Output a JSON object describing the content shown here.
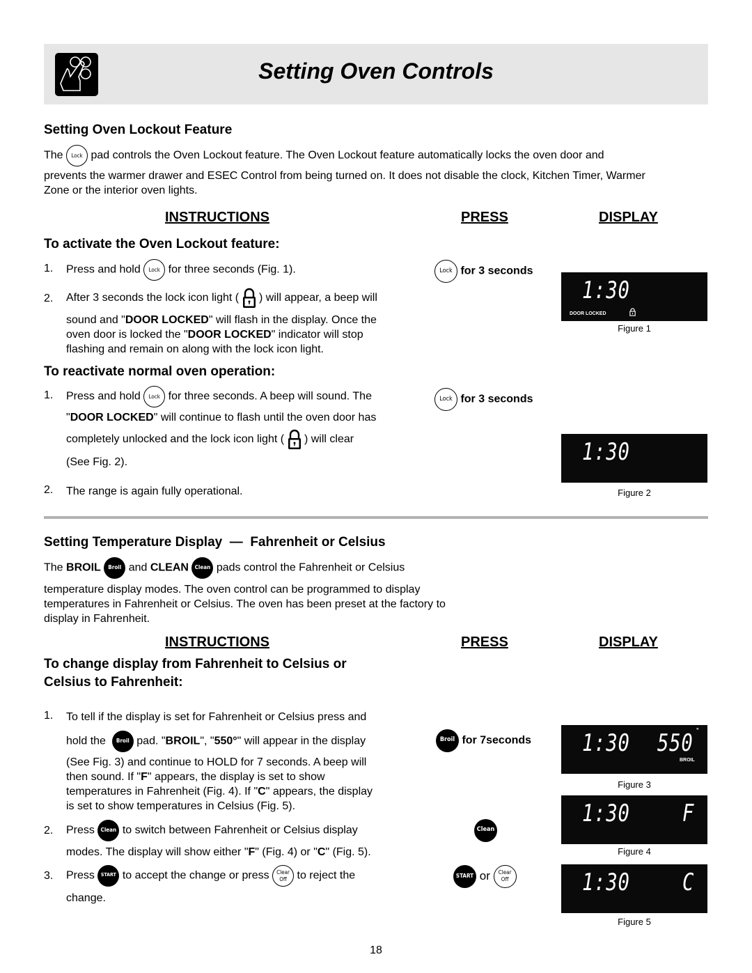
{
  "header": {
    "title": "Setting Oven Controls",
    "icon": "hand-pressing-buttons-icon"
  },
  "lockout": {
    "heading": "Setting Oven Lockout Feature",
    "intro_pre": "The",
    "intro_pad": "Lock",
    "intro_post": "pad controls the Oven Lockout feature. The Oven Lockout feature automatically locks the oven door and",
    "intro_line2": "prevents the warmer drawer and ESEC Control from being turned on.  It does not disable the clock, Kitchen Timer, Warmer",
    "intro_line3": "Zone or the interior oven lights.",
    "col_instructions": "INSTRUCTIONS",
    "col_press": "PRESS",
    "col_display": "DISPLAY",
    "activate": {
      "heading": "To activate the Oven Lockout feature:",
      "step1_num": "1.",
      "step1_pre": "Press and hold",
      "step1_pad": "Lock",
      "step1_post": "for three seconds (Fig. 1).",
      "step2_num": "2.",
      "step2_pre": "After 3 seconds the lock icon light (",
      "step2_post": ") will appear, a beep will",
      "step2_l2a": "sound and \"",
      "step2_l2b": "DOOR LOCKED",
      "step2_l2c": "\" will flash in the display. Once the",
      "step2_l3a": "oven door is locked the \"",
      "step2_l3b": "DOOR LOCKED",
      "step2_l3c": "\" indicator will stop",
      "step2_l4": "flashing and remain on along with the lock icon light.",
      "press_pad": "Lock",
      "press_label": "for 3 seconds",
      "display_time": "1:30",
      "display_indicator": "DOOR LOCKED",
      "figure": "Figure 1"
    },
    "reactivate": {
      "heading": "To reactivate normal oven operation:",
      "step1_num": "1.",
      "step1_pre": "Press and hold",
      "step1_pad": "Lock",
      "step1_post": "for three seconds. A beep will sound. The",
      "step1_l2a": "\"",
      "step1_l2b": "DOOR LOCKED",
      "step1_l2c": "\" will continue to flash until the oven door has",
      "step1_l3a": "completely unlocked and the lock icon light (",
      "step1_l3b": ") will clear",
      "step1_l4": "(See Fig. 2).",
      "step2_num": "2.",
      "step2": "The range is again fully operational.",
      "press_pad": "Lock",
      "press_label": "for 3 seconds",
      "display_time": "1:30",
      "figure": "Figure 2"
    }
  },
  "temperature": {
    "heading": "Setting Temperature Display  —  Fahrenheit or Celsius",
    "intro_a": "The ",
    "intro_broil": "BROIL",
    "intro_pad_broil": "Broil",
    "intro_and": "and ",
    "intro_clean": "CLEAN",
    "intro_pad_clean": "Clean",
    "intro_post": "pads control the Fahrenheit or Celsius",
    "intro_l2": "temperature display modes. The oven control can be programmed to display",
    "intro_l3": "temperatures in Fahrenheit or Celsius.  The oven has been preset at the factory to",
    "intro_l4": "display in Fahrenheit.",
    "col_instructions": "INSTRUCTIONS",
    "col_press": "PRESS",
    "col_display": "DISPLAY",
    "change_heading_l1": "To change display from Fahrenheit to Celsius or",
    "change_heading_l2": "Celsius to Fahrenheit:",
    "step1_num": "1.",
    "step1_l1": "To tell if the display is set for Fahrenheit or Celsius press and",
    "step1_l2a": "hold the",
    "step1_pad": "Broil",
    "step1_l2b": "pad. \"",
    "step1_l2c": "BROIL",
    "step1_l2d": "\", \"",
    "step1_l2e": "550°",
    "step1_l2f": "\" will appear in the display",
    "step1_l3": "(See Fig. 3) and continue to HOLD for 7 seconds. A beep will",
    "step1_l4a": "then sound.  If \"",
    "step1_l4b": "F",
    "step1_l4c": "\" appears, the display is set to show",
    "step1_l5a": "temperatures in Fahrenheit (Fig. 4).  If \"",
    "step1_l5b": "C",
    "step1_l5c": "\" appears, the display",
    "step1_l6": "is set to show temperatures in Celsius (Fig. 5).",
    "step2_num": "2.",
    "step2_pre": "Press",
    "step2_pad": "Clean",
    "step2_post": "to switch between Fahrenheit or Celsius display",
    "step2_l2a": "modes. The display will show either \"",
    "step2_l2b": "F",
    "step2_l2c": "\" (Fig. 4) or \"",
    "step2_l2d": "C",
    "step2_l2e": "\" (Fig. 5).",
    "step3_num": "3.",
    "step3_pre": "Press",
    "step3_pad_start": "START",
    "step3_mid": "to accept the change or press",
    "step3_pad_clear_l1": "Clear",
    "step3_pad_clear_l2": "Off",
    "step3_post": "to reject the",
    "step3_l2": "change.",
    "press1_pad": "Broil",
    "press1_label": "for 7seconds",
    "press2_pad": "Clean",
    "press3_pad_start": "START",
    "press3_or": "or",
    "press3_pad_clear_l1": "Clear",
    "press3_pad_clear_l2": "Off",
    "fig3": {
      "time": "1:30",
      "temp": "550",
      "degree": "°",
      "mode": "BROIL",
      "caption": "Figure 3"
    },
    "fig4": {
      "time": "1:30",
      "unit": "F",
      "caption": "Figure 4"
    },
    "fig5": {
      "time": "1:30",
      "unit": "C",
      "caption": "Figure 5"
    }
  },
  "page_number": "18"
}
